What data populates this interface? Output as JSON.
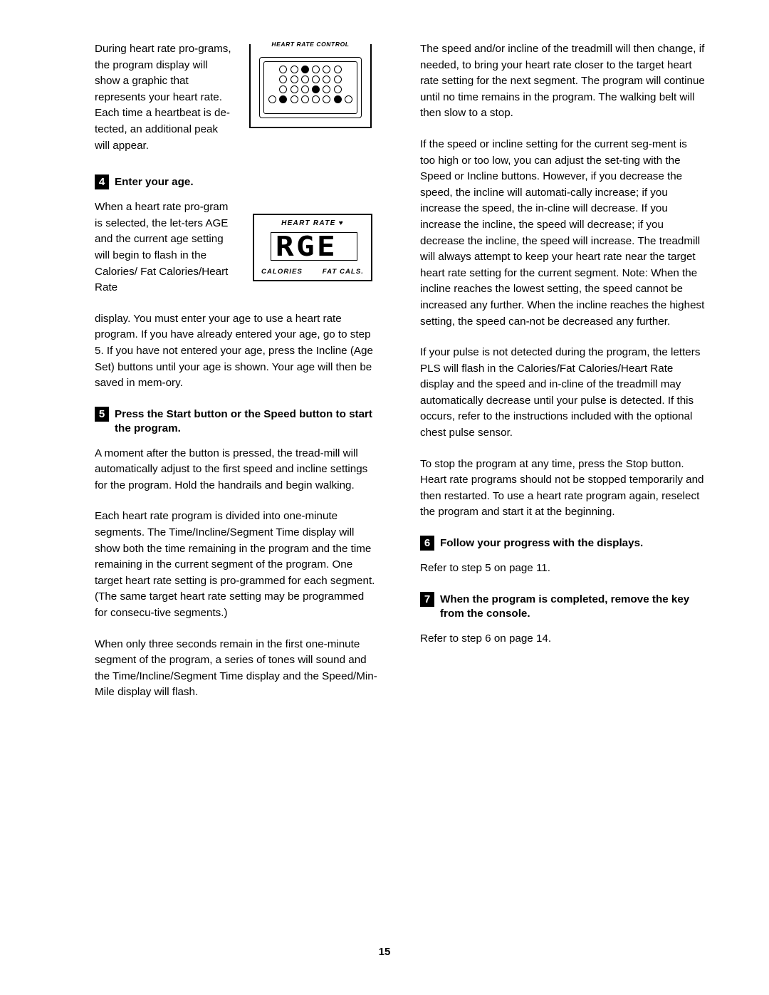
{
  "page": {
    "number": "15"
  },
  "left_column": {
    "intro_paragraph": "During heart rate pro-grams, the program display will show a graphic that represents your heart rate. Each time a heartbeat is de-tected, an additional peak will appear.",
    "step4": {
      "number": "4",
      "heading": "Enter your age.",
      "para_narrow": "When a heart rate pro-gram is selected, the let-ters AGE and the current age setting will begin to flash in the Calories/ Fat Calories/Heart Rate",
      "para_wide": "display. You must enter your age to use a heart rate program. If you have already entered your age, go to step 5. If you have not entered your age, press the Incline (Age Set) buttons until your age is shown. Your age will then be saved in mem-ory."
    },
    "step5": {
      "number": "5",
      "heading": "Press the Start button or the Speed    button to start the program.",
      "para1": "A moment after the button is pressed, the tread-mill will automatically adjust to the first speed and incline settings for the program. Hold the handrails and begin walking.",
      "para2": "Each heart rate program is divided into one-minute segments. The Time/Incline/Segment Time display will show both the time remaining in the program and the time remaining in the current segment of the program. One target heart rate setting is pro-grammed for each segment. (The same target heart rate setting may be programmed for consecu-tive segments.)",
      "para3": "When only three seconds remain in the first one-minute segment of the program, a series of tones will sound and the Time/Incline/Segment Time display and the Speed/Min-Mile display will flash."
    }
  },
  "figures": {
    "hr_control": {
      "caption": "HEART RATE CONTROL",
      "rows": [
        [
          "blank",
          "open",
          "open",
          "filled",
          "open",
          "open",
          "open",
          "blank"
        ],
        [
          "blank",
          "open",
          "open",
          "open",
          "open",
          "open",
          "open",
          "blank"
        ],
        [
          "blank",
          "open",
          "open",
          "open",
          "filled",
          "open",
          "open",
          "blank"
        ],
        [
          "open",
          "filled",
          "open",
          "open",
          "open",
          "open",
          "filled",
          "open"
        ]
      ]
    },
    "age_display": {
      "header_label": "HEART RATE",
      "header_icon": "heart-icon",
      "value": "AGE",
      "segment_text": "RGE",
      "left_label": "CALORIES",
      "right_label": "FAT CALS."
    }
  },
  "right_column": {
    "para1": "The speed and/or incline of the treadmill will then change, if needed, to bring your heart rate closer to the target heart rate setting for the next segment. The program will continue until no time remains in the program. The walking belt will then slow to a stop.",
    "para2": "If the speed or incline setting for the current seg-ment is too high or too low, you can adjust the set-ting with the Speed or Incline buttons. However, if you decrease the speed, the incline will automati-cally increase; if you increase the speed, the in-cline will decrease. If you increase the incline, the speed will decrease; if you decrease the incline, the speed will increase. The treadmill will always attempt to keep your heart rate near the target heart rate setting for the current segment. Note: When the incline reaches the lowest setting, the speed cannot be increased any further. When the incline reaches the highest setting, the speed can-not be decreased any further.",
    "para3": "If your pulse is not detected during the program, the letters PLS will flash in the Calories/Fat Calories/Heart Rate display and the speed and in-cline of the treadmill may automatically decrease until your pulse is detected. If this occurs, refer to the instructions included with the optional chest pulse sensor.",
    "para4": "To stop the program at any time, press the Stop button. Heart rate programs should not be stopped temporarily and then restarted. To use a heart rate program again, reselect the program and start it at the beginning.",
    "step6": {
      "number": "6",
      "heading": "Follow your progress with the displays.",
      "para": "Refer to step 5 on page 11."
    },
    "step7": {
      "number": "7",
      "heading": "When the program is completed, remove the key from the console.",
      "para": "Refer to step 6 on page 14."
    }
  }
}
